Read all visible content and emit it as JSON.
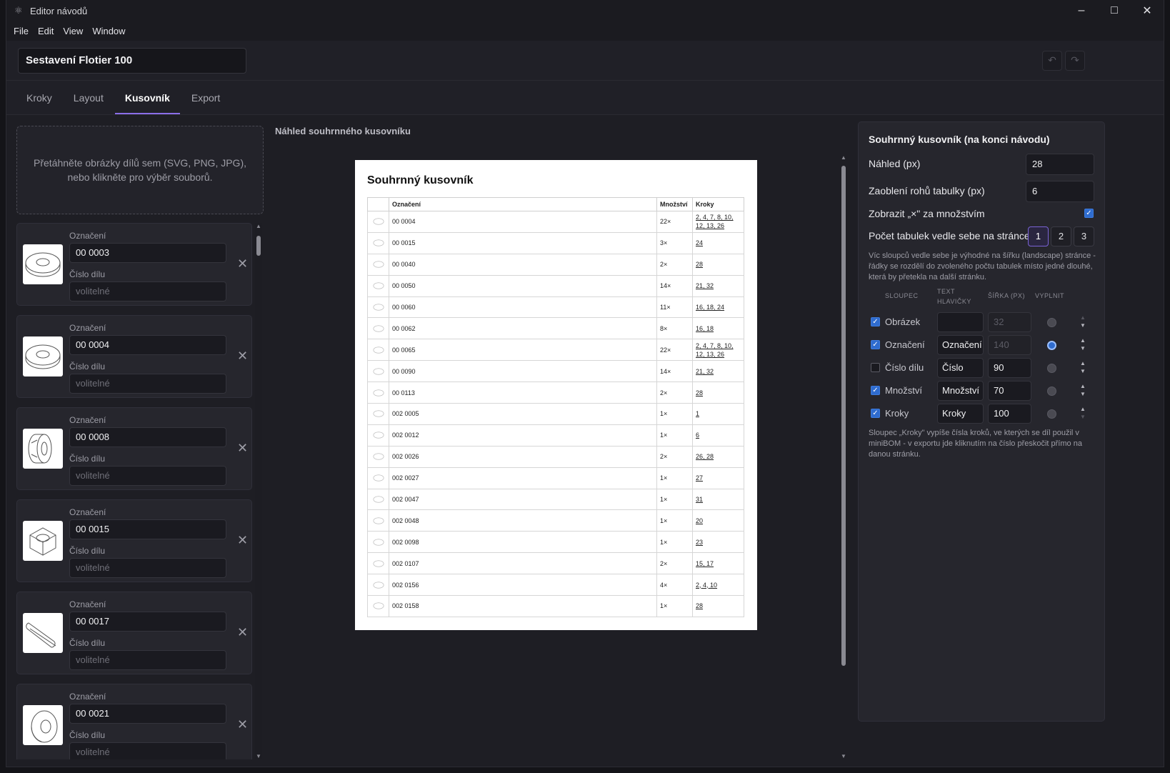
{
  "window": {
    "title": "Editor návodů",
    "icon": "gear-atom-icon",
    "controls": [
      "minimize-icon",
      "maximize-icon",
      "close-icon"
    ]
  },
  "menu": [
    "File",
    "Edit",
    "View",
    "Window"
  ],
  "header": {
    "document_title": "Sestavení Flotier 100",
    "undo_icon": "undo-icon",
    "redo_icon": "redo-icon"
  },
  "tabs": [
    {
      "label": "Kroky",
      "active": false
    },
    {
      "label": "Layout",
      "active": false
    },
    {
      "label": "Kusovník",
      "active": true
    },
    {
      "label": "Export",
      "active": false
    }
  ],
  "left_panel": {
    "dropzone_text": "Přetáhněte obrázky dílů sem (SVG, PNG, JPG), nebo klikněte pro výběr souborů.",
    "label_designation": "Označení",
    "label_part_number": "Číslo dílu",
    "placeholder_part_number": "volitelné",
    "parts": [
      {
        "designation": "00 0003",
        "thumb": "washer"
      },
      {
        "designation": "00 0004",
        "thumb": "washer"
      },
      {
        "designation": "00 0008",
        "thumb": "bearing"
      },
      {
        "designation": "00 0015",
        "thumb": "nut"
      },
      {
        "designation": "00 0017",
        "thumb": "key"
      },
      {
        "designation": "00 0021",
        "thumb": "ring"
      }
    ]
  },
  "center": {
    "preview_title": "Náhled souhrnného kusovníku",
    "paper_title": "Souhrnný kusovník",
    "table_headers": [
      "Označení",
      "Množství",
      "Kroky"
    ],
    "rows": [
      {
        "designation": "00 0004",
        "qty": "22×",
        "steps": "2, 4, 7, 8, 10, 12, 13, 26"
      },
      {
        "designation": "00 0015",
        "qty": "3×",
        "steps": "24"
      },
      {
        "designation": "00 0040",
        "qty": "2×",
        "steps": "28"
      },
      {
        "designation": "00 0050",
        "qty": "14×",
        "steps": "21, 32"
      },
      {
        "designation": "00 0060",
        "qty": "11×",
        "steps": "16, 18, 24"
      },
      {
        "designation": "00 0062",
        "qty": "8×",
        "steps": "16, 18"
      },
      {
        "designation": "00 0065",
        "qty": "22×",
        "steps": "2, 4, 7, 8, 10, 12, 13, 26"
      },
      {
        "designation": "00 0090",
        "qty": "14×",
        "steps": "21, 32"
      },
      {
        "designation": "00 0113",
        "qty": "2×",
        "steps": "28"
      },
      {
        "designation": "002 0005",
        "qty": "1×",
        "steps": "1"
      },
      {
        "designation": "002 0012",
        "qty": "1×",
        "steps": "6"
      },
      {
        "designation": "002 0026",
        "qty": "2×",
        "steps": "26, 28"
      },
      {
        "designation": "002 0027",
        "qty": "1×",
        "steps": "27"
      },
      {
        "designation": "002 0047",
        "qty": "1×",
        "steps": "31"
      },
      {
        "designation": "002 0048",
        "qty": "1×",
        "steps": "20"
      },
      {
        "designation": "002 0098",
        "qty": "1×",
        "steps": "23"
      },
      {
        "designation": "002 0107",
        "qty": "2×",
        "steps": "15, 17"
      },
      {
        "designation": "002 0156",
        "qty": "4×",
        "steps": "2, 4, 10"
      },
      {
        "designation": "002 0158",
        "qty": "1×",
        "steps": "28"
      }
    ]
  },
  "right_panel": {
    "title": "Souhrnný kusovník (na konci návodu)",
    "preview_label": "Náhled (px)",
    "preview_value": "28",
    "radius_label": "Zaoblení rohů tabulky (px)",
    "radius_value": "6",
    "show_x_label": "Zobrazit „×\" za množstvím",
    "show_x_checked": true,
    "tables_side_label": "Počet tabulek vedle sebe na stránce",
    "tables_side_options": [
      "1",
      "2",
      "3"
    ],
    "tables_side_selected": "1",
    "hint_tables": "Víc sloupců vedle sebe je výhodné na šířku (landscape) stránce - řádky se rozdělí do zvoleného počtu tabulek místo jedné dlouhé, která by přetekla na další stránku.",
    "col_headers": {
      "column": "SLOUPEC",
      "header_text": "TEXT HLAVIČKY",
      "width": "ŠÍŘKA (PX)",
      "fill": "VYPLNIT"
    },
    "columns": [
      {
        "name": "Obrázek",
        "checked": true,
        "header": "",
        "width": "32",
        "width_disabled": true,
        "fill": false
      },
      {
        "name": "Označení",
        "checked": true,
        "header": "Označení",
        "width": "140",
        "width_disabled": true,
        "fill": true
      },
      {
        "name": "Číslo dílu",
        "checked": false,
        "header": "Číslo dílu",
        "width": "90",
        "width_disabled": false,
        "fill": false
      },
      {
        "name": "Množství",
        "checked": true,
        "header": "Množství",
        "width": "70",
        "width_disabled": false,
        "fill": false
      },
      {
        "name": "Kroky",
        "checked": true,
        "header": "Kroky",
        "width": "100",
        "width_disabled": false,
        "fill": false
      }
    ],
    "hint_steps": "Sloupec „Kroky\" vypíše čísla kroků, ve kterých se díl použil v miniBOM - v exportu jde kliknutím na číslo přeskočit přímo na danou stránku."
  }
}
